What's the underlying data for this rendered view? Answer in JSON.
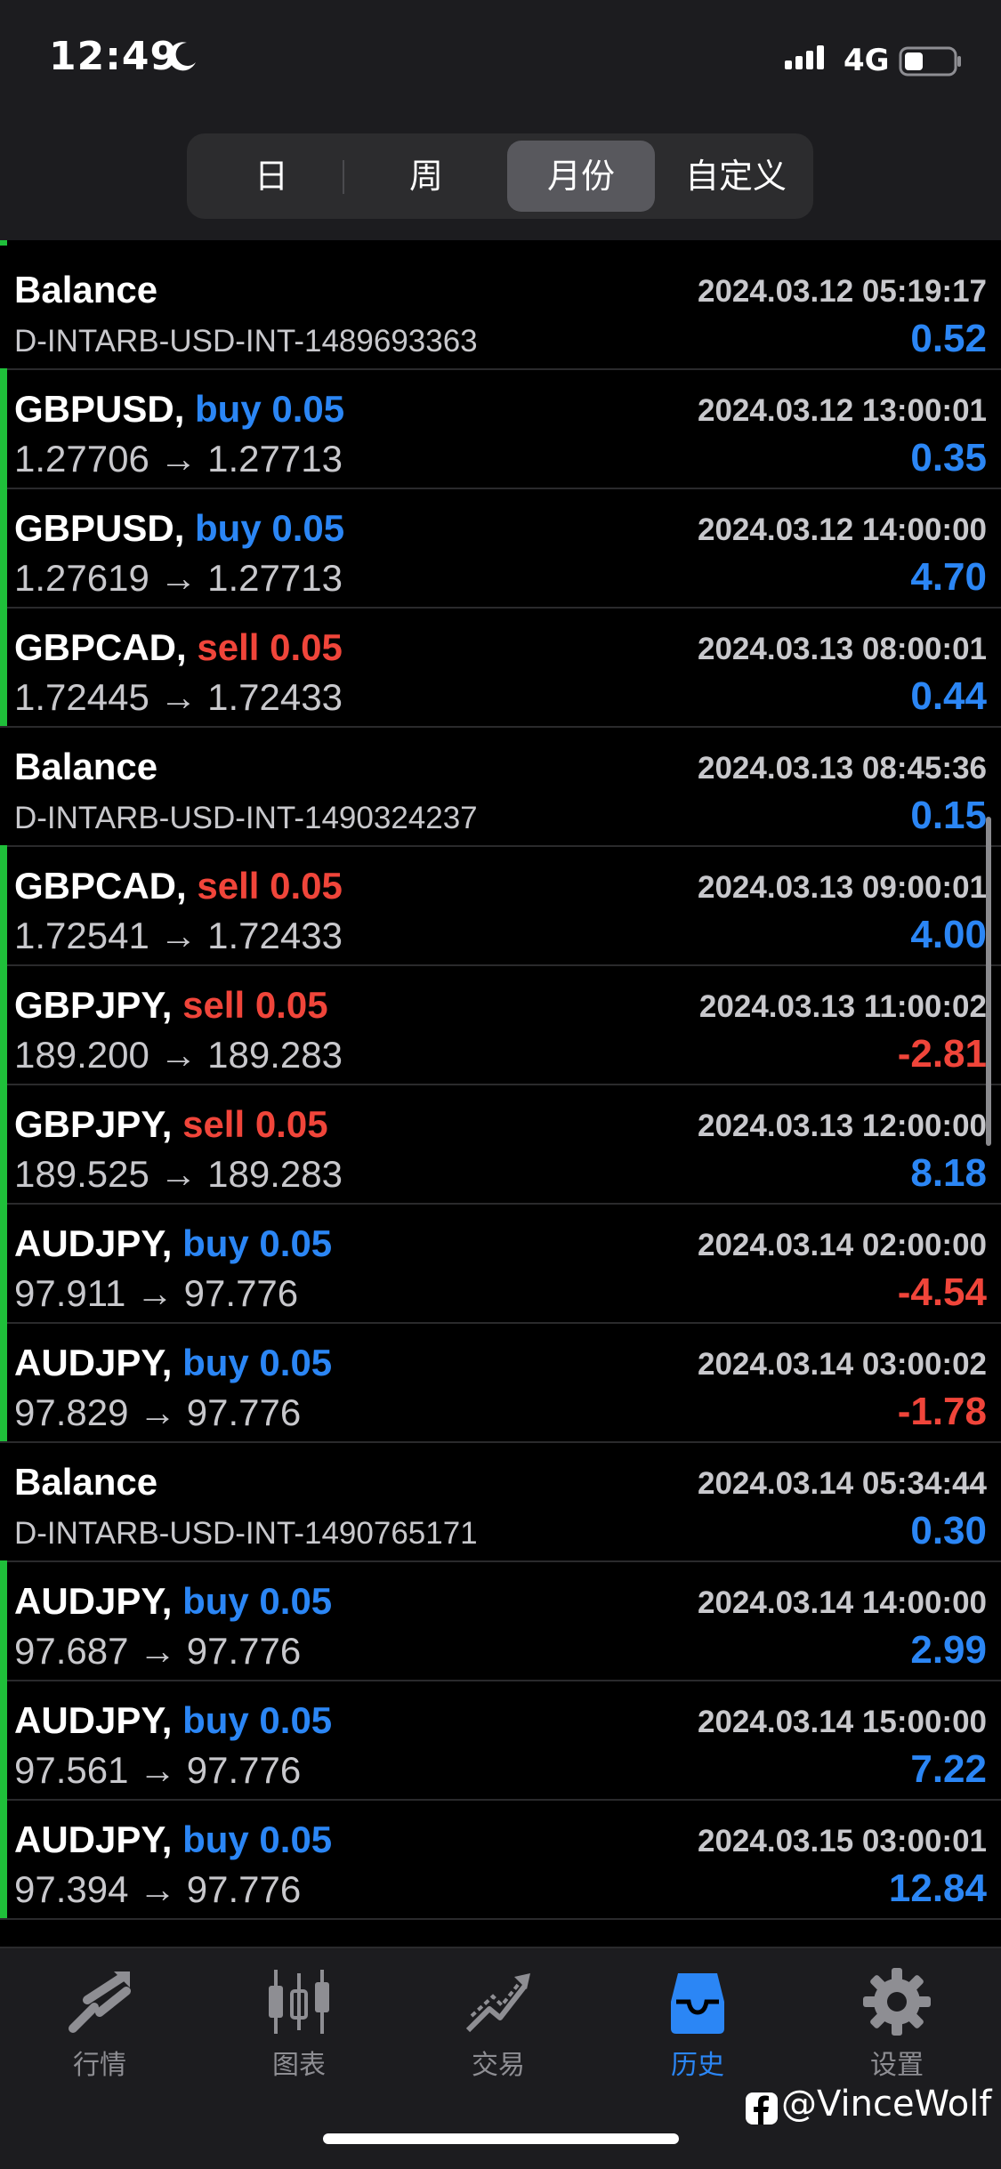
{
  "status": {
    "time": "12:49",
    "network": "4G"
  },
  "segments": [
    {
      "label": "日",
      "active": false
    },
    {
      "label": "周",
      "active": false
    },
    {
      "label": "月份",
      "active": true
    },
    {
      "label": "自定义",
      "active": false
    }
  ],
  "rows": [
    {
      "kind": "balance",
      "title": "Balance",
      "time": "2024.03.12 05:19:17",
      "sub": "D-INTARB-USD-INT-1489693363",
      "profit": "0.52",
      "profit_sign": "pos"
    },
    {
      "kind": "trade",
      "symbol": "GBPUSD,",
      "side": "buy 0.05",
      "side_type": "buy",
      "time": "2024.03.12 13:00:01",
      "sub": "1.27706 → 1.27713",
      "profit": "0.35",
      "profit_sign": "pos"
    },
    {
      "kind": "trade",
      "symbol": "GBPUSD,",
      "side": "buy 0.05",
      "side_type": "buy",
      "time": "2024.03.12 14:00:00",
      "sub": "1.27619 → 1.27713",
      "profit": "4.70",
      "profit_sign": "pos"
    },
    {
      "kind": "trade",
      "symbol": "GBPCAD,",
      "side": "sell 0.05",
      "side_type": "sell",
      "time": "2024.03.13 08:00:01",
      "sub": "1.72445 → 1.72433",
      "profit": "0.44",
      "profit_sign": "pos"
    },
    {
      "kind": "balance",
      "title": "Balance",
      "time": "2024.03.13 08:45:36",
      "sub": "D-INTARB-USD-INT-1490324237",
      "profit": "0.15",
      "profit_sign": "pos"
    },
    {
      "kind": "trade",
      "symbol": "GBPCAD,",
      "side": "sell 0.05",
      "side_type": "sell",
      "time": "2024.03.13 09:00:01",
      "sub": "1.72541 → 1.72433",
      "profit": "4.00",
      "profit_sign": "pos"
    },
    {
      "kind": "trade",
      "symbol": "GBPJPY,",
      "side": "sell 0.05",
      "side_type": "sell",
      "time": "2024.03.13 11:00:02",
      "sub": "189.200 → 189.283",
      "profit": "-2.81",
      "profit_sign": "neg"
    },
    {
      "kind": "trade",
      "symbol": "GBPJPY,",
      "side": "sell 0.05",
      "side_type": "sell",
      "time": "2024.03.13 12:00:00",
      "sub": "189.525 → 189.283",
      "profit": "8.18",
      "profit_sign": "pos"
    },
    {
      "kind": "trade",
      "symbol": "AUDJPY,",
      "side": "buy 0.05",
      "side_type": "buy",
      "time": "2024.03.14 02:00:00",
      "sub": "97.911 → 97.776",
      "profit": "-4.54",
      "profit_sign": "neg"
    },
    {
      "kind": "trade",
      "symbol": "AUDJPY,",
      "side": "buy 0.05",
      "side_type": "buy",
      "time": "2024.03.14 03:00:02",
      "sub": "97.829 → 97.776",
      "profit": "-1.78",
      "profit_sign": "neg"
    },
    {
      "kind": "balance",
      "title": "Balance",
      "time": "2024.03.14 05:34:44",
      "sub": "D-INTARB-USD-INT-1490765171",
      "profit": "0.30",
      "profit_sign": "pos"
    },
    {
      "kind": "trade",
      "symbol": "AUDJPY,",
      "side": "buy 0.05",
      "side_type": "buy",
      "time": "2024.03.14 14:00:00",
      "sub": "97.687 → 97.776",
      "profit": "2.99",
      "profit_sign": "pos"
    },
    {
      "kind": "trade",
      "symbol": "AUDJPY,",
      "side": "buy 0.05",
      "side_type": "buy",
      "time": "2024.03.14 15:00:00",
      "sub": "97.561 → 97.776",
      "profit": "7.22",
      "profit_sign": "pos"
    },
    {
      "kind": "trade",
      "symbol": "AUDJPY,",
      "side": "buy 0.05",
      "side_type": "buy",
      "time": "2024.03.15 03:00:01",
      "sub": "97.394 → 97.776",
      "profit": "12.84",
      "profit_sign": "pos"
    }
  ],
  "tabs": [
    {
      "label": "行情",
      "icon": "quotes-icon",
      "active": false
    },
    {
      "label": "图表",
      "icon": "candlestick-chart-icon",
      "active": false
    },
    {
      "label": "交易",
      "icon": "trade-icon",
      "active": false
    },
    {
      "label": "历史",
      "icon": "history-inbox-icon",
      "active": true
    },
    {
      "label": "设置",
      "icon": "gear-icon",
      "active": false
    }
  ],
  "watermark": "@VinceWolf",
  "colors": {
    "buy": "#2b86f5",
    "sell": "#f0453a",
    "bar": "#1fbf3a",
    "active_tab": "#2b86f5"
  }
}
